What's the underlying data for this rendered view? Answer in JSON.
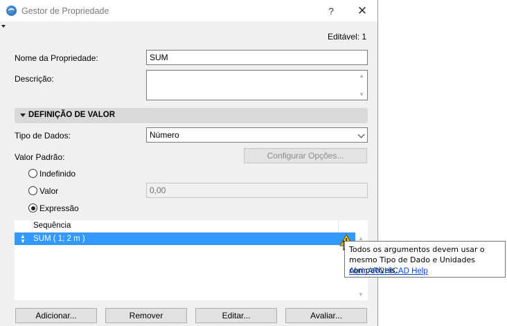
{
  "window": {
    "title": "Gestor de Propriedade",
    "help_label": "?",
    "close_label": "✕"
  },
  "editable_label": "Editável: 1",
  "property_name": {
    "label": "Nome da Propriedade:",
    "value": "SUM"
  },
  "description": {
    "label": "Descrição:",
    "value": ""
  },
  "section": {
    "title": "DEFINIÇÃO DE VALOR"
  },
  "data_type": {
    "label": "Tipo de Dados:",
    "value": "Número"
  },
  "default_value": {
    "label": "Valor Padrão:",
    "configure_button": "Configurar Opções...",
    "options": [
      {
        "label": "Indefinido",
        "checked": false
      },
      {
        "label": "Valor",
        "checked": false
      },
      {
        "label": "Expressão",
        "checked": true
      }
    ],
    "value_field": "0,00"
  },
  "expression_list": {
    "header": "Sequência",
    "rows": [
      {
        "text": "SUM ( 1; 2 m )",
        "selected": true
      }
    ]
  },
  "tooltip": {
    "message": "Todos os argumentos devem usar o mesmo Tipo de Dado e Unidades compatíveis.",
    "link": "Abrir ARCHICAD Help"
  },
  "buttons": {
    "add": "Adicionar...",
    "remove": "Remover",
    "edit": "Editar...",
    "evaluate": "Avaliar..."
  },
  "colors": {
    "selection": "#3399ff",
    "link": "#0645d0",
    "warning": "#f5c400"
  }
}
